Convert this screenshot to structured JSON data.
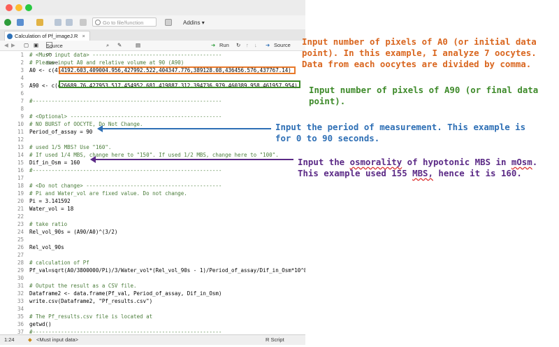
{
  "toolbar": {
    "goto_placeholder": "Go to file/function",
    "addins_label": "Addins"
  },
  "editor": {
    "tab_label": "Calculation of Pf_imageJ.R",
    "tab_close": "×",
    "source_on_save": "Source on Save",
    "run_label": "Run",
    "source_label": "Source"
  },
  "code_lines": [
    {
      "n": "1",
      "t": "# <Must input data> -----------------------------------------",
      "cls": "c"
    },
    {
      "n": "2",
      "t": "# Please input A0 and relative volume at 90 (A90)",
      "cls": "c"
    },
    {
      "n": "3",
      "t": "A0 <- c(414192.603,409004.956,427992.522,404347.776,389128.08,436456.576,437767.14)",
      "cls": ""
    },
    {
      "n": "4",
      "t": "",
      "cls": ""
    },
    {
      "n": "5",
      "t": "A90 <- c(426689.76,427953.517,454952.681,419887.312,394736.979,460389.958,461957.954)",
      "cls": ""
    },
    {
      "n": "6",
      "t": "",
      "cls": ""
    },
    {
      "n": "7",
      "t": "#------------------------------------------------------------",
      "cls": "c"
    },
    {
      "n": "8",
      "t": "",
      "cls": ""
    },
    {
      "n": "9",
      "t": "# <Optional> ------------------------------------------------",
      "cls": "c"
    },
    {
      "n": "10",
      "t": "# NO BURST of OOCYTE, Do Not Change.",
      "cls": "c"
    },
    {
      "n": "11",
      "t": "Period_of_assay = 90",
      "cls": ""
    },
    {
      "n": "12",
      "t": "",
      "cls": ""
    },
    {
      "n": "13",
      "t": "# used 1/5 MBS? Use \"160\".",
      "cls": "c"
    },
    {
      "n": "14",
      "t": "# If used 1/4 MBS, change here to \"150\". If used 1/2 MBS, change here to \"100\".",
      "cls": "c"
    },
    {
      "n": "15",
      "t": "Dif_in_Osm = 160",
      "cls": ""
    },
    {
      "n": "16",
      "t": "#------------------------------------------------------------",
      "cls": "c"
    },
    {
      "n": "17",
      "t": "",
      "cls": ""
    },
    {
      "n": "18",
      "t": "# <Do not change> -------------------------------------------",
      "cls": "c"
    },
    {
      "n": "19",
      "t": "# Pi and Water_vol are fixed value. Do not change.",
      "cls": "c"
    },
    {
      "n": "20",
      "t": "Pi = 3.141592",
      "cls": ""
    },
    {
      "n": "21",
      "t": "Water_vol = 18",
      "cls": ""
    },
    {
      "n": "22",
      "t": "",
      "cls": ""
    },
    {
      "n": "23",
      "t": "# take ratio",
      "cls": "c"
    },
    {
      "n": "24",
      "t": "Rel_vol_90s = (A90/A0)^(3/2)",
      "cls": ""
    },
    {
      "n": "25",
      "t": "",
      "cls": ""
    },
    {
      "n": "26",
      "t": "Rel_vol_90s",
      "cls": ""
    },
    {
      "n": "27",
      "t": "",
      "cls": ""
    },
    {
      "n": "28",
      "t": "# calculation of Pf",
      "cls": "c"
    },
    {
      "n": "29",
      "t": "Pf_val=sqrt(A0/3800000/Pi)/3/Water_vol*(Rel_vol_90s - 1)/Period_of_assay/Dif_in_Osm*10^8",
      "cls": ""
    },
    {
      "n": "30",
      "t": "",
      "cls": ""
    },
    {
      "n": "31",
      "t": "# Output the result as a CSV file.",
      "cls": "c"
    },
    {
      "n": "32",
      "t": "Dataframe2 <- data.frame(Pf_val, Period_of_assay, Dif_in_Osm)",
      "cls": ""
    },
    {
      "n": "33",
      "t": "write.csv(Dataframe2, \"Pf_results.csv\")",
      "cls": ""
    },
    {
      "n": "34",
      "t": "",
      "cls": ""
    },
    {
      "n": "35",
      "t": "# The Pf_results.csv file is located at",
      "cls": "c"
    },
    {
      "n": "36",
      "t": "getwd()",
      "cls": ""
    },
    {
      "n": "37",
      "t": "#------------------------------------------------------------",
      "cls": "c"
    }
  ],
  "status": {
    "position": "1:24",
    "section": "<Must input data>",
    "filetype": "R Script"
  },
  "annotations": {
    "a0": {
      "text": "Input number of pixels of A0 (or initial data\npoint). In this example, I analyze 7 oocytes.\nData from each oocytes are divided by comma.",
      "color": "#d9661f"
    },
    "a90": {
      "text": "Input number of pixels of A90 (or final data\npoint).",
      "color": "#3e8a2a"
    },
    "period": {
      "text": "Input the period of measurement. This example is\nfor 0 to 90 seconds.",
      "color": "#2e6fb5"
    },
    "osm": {
      "line1a": "Input the ",
      "line1b": "osmorality",
      "line1c": " of hypotonic MBS in ",
      "line1d": "mOsm",
      "line1e": ".",
      "line2a": "This example used 155 ",
      "line2b": "MBS,",
      "line2c": " hence it is 160.",
      "color": "#5b2a86"
    }
  }
}
